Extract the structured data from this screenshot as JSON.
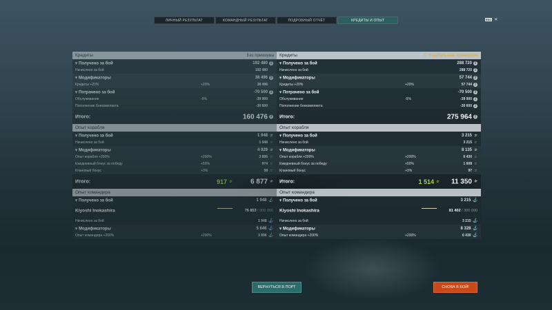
{
  "tabs": [
    "ЛИЧНЫЙ РЕЗУЛЬТАТ",
    "КОМАНДНЫЙ РЕЗУЛЬТАТ",
    "ПОДРОБНЫЙ ОТЧЁТ",
    "КРЕДИТЫ И ОПЫТ"
  ],
  "hud": {
    "key": "ESC",
    "close": "✕"
  },
  "icons": {
    "credits": "coin-icon",
    "xp": "star-icon",
    "commander_xp": "anchor-icon",
    "expand": "chevron-down-icon"
  },
  "left": {
    "credits": {
      "title": "Кредиты",
      "note": "Без премиума",
      "earned": {
        "label": "Получено за бой",
        "value": "192 480",
        "sub_label": "Начислено за бой",
        "sub_value": "192 480"
      },
      "mods": {
        "label": "Модификаторы",
        "value": "38 496",
        "sub_label": "Кредиты +20%",
        "sub_pct": "+20%",
        "sub_value": "38 496"
      },
      "spent": {
        "label": "Потрачено за бой",
        "value": "-70 500",
        "r1_label": "Обслуживание",
        "r1_pct": "-5%",
        "r1_value": "-39 900",
        "r2_label": "Пополнение боекомплекта",
        "r2_value": "-30 600"
      },
      "total_label": "Итого:",
      "total_value": "160 476"
    },
    "ship": {
      "title": "Опыт корабля",
      "earned": {
        "label": "Получено за бой",
        "value": "1 948",
        "sub_label": "Начислено за бой",
        "sub_value": "1 948"
      },
      "mods": {
        "label": "Модификаторы",
        "value": "4 929",
        "r1_label": "Опыт корабля +200%",
        "r1_pct": "+200%",
        "r1_value": "3 896",
        "r2_label": "Ежедневный бонус за победу",
        "r2_pct": "+50%",
        "r2_value": "974",
        "r3_label": "Клановый бонус",
        "r3_pct": "+3%",
        "r3_value": "58"
      },
      "total_label": "Итого:",
      "bonus": "917",
      "total_value": "6 877"
    },
    "commander": {
      "title": "Опыт командира",
      "earned": {
        "label": "Получено за бой",
        "value": "1 948"
      },
      "name": "Kiyoshi Inokashira",
      "progress": "76 853",
      "progress_max": " / 300 000",
      "sub_label": "Начислено за бой",
      "sub_value": "1 948",
      "mods": {
        "label": "Модификаторы",
        "value": "5 846",
        "sub_label": "Опыт командира +200%",
        "sub_pct": "+200%",
        "sub_value": "3 896"
      }
    }
  },
  "right": {
    "credits": {
      "title": "Кредиты",
      "note": "С Корабельным премиумом",
      "earned": {
        "label": "Получено за бой",
        "value": "288 720",
        "sub_label": "Начислено за бой",
        "sub_value": "288 720"
      },
      "mods": {
        "label": "Модификаторы",
        "value": "57 744",
        "sub_label": "Кредиты +20%",
        "sub_pct": "+20%",
        "sub_value": "57 744"
      },
      "spent": {
        "label": "Потрачено за бой",
        "value": "-70 500",
        "r1_label": "Обслуживание",
        "r1_pct": "-5%",
        "r1_value": "-39 900",
        "r2_label": "Пополнение боекомплекта",
        "r2_value": "-30 600"
      },
      "total_label": "Итого:",
      "total_value": "275 964"
    },
    "ship": {
      "title": "Опыт корабля",
      "earned": {
        "label": "Получено за бой",
        "value": "3 215",
        "sub_label": "Начислено за бой",
        "sub_value": "3 215"
      },
      "mods": {
        "label": "Модификаторы",
        "value": "8 135",
        "r1_label": "Опыт корабля +200%",
        "r1_pct": "+200%",
        "r1_value": "6 430",
        "r2_label": "Ежедневный бонус за победу",
        "r2_pct": "+50%",
        "r2_value": "1 608",
        "r3_label": "Клановый бонус",
        "r3_pct": "+3%",
        "r3_value": "97"
      },
      "total_label": "Итого:",
      "bonus": "1 514",
      "total_value": "11 350"
    },
    "commander": {
      "title": "Опыт командира",
      "earned": {
        "label": "Получено за бой",
        "value": "3 215"
      },
      "name": "Kiyoshi Inokashira",
      "progress": "81 402",
      "progress_max": " / 300 000",
      "sub_label": "Начислено за бой",
      "sub_value": "3 215",
      "mods": {
        "label": "Модификаторы",
        "value": "8 328",
        "sub_label": "Опыт командира +200%",
        "sub_pct": "+200%",
        "sub_value": "6 430"
      }
    }
  },
  "buttons": {
    "port": "ВЕРНУТЬСЯ В ПОРТ",
    "battle": "СНОВА В БОЙ!"
  }
}
